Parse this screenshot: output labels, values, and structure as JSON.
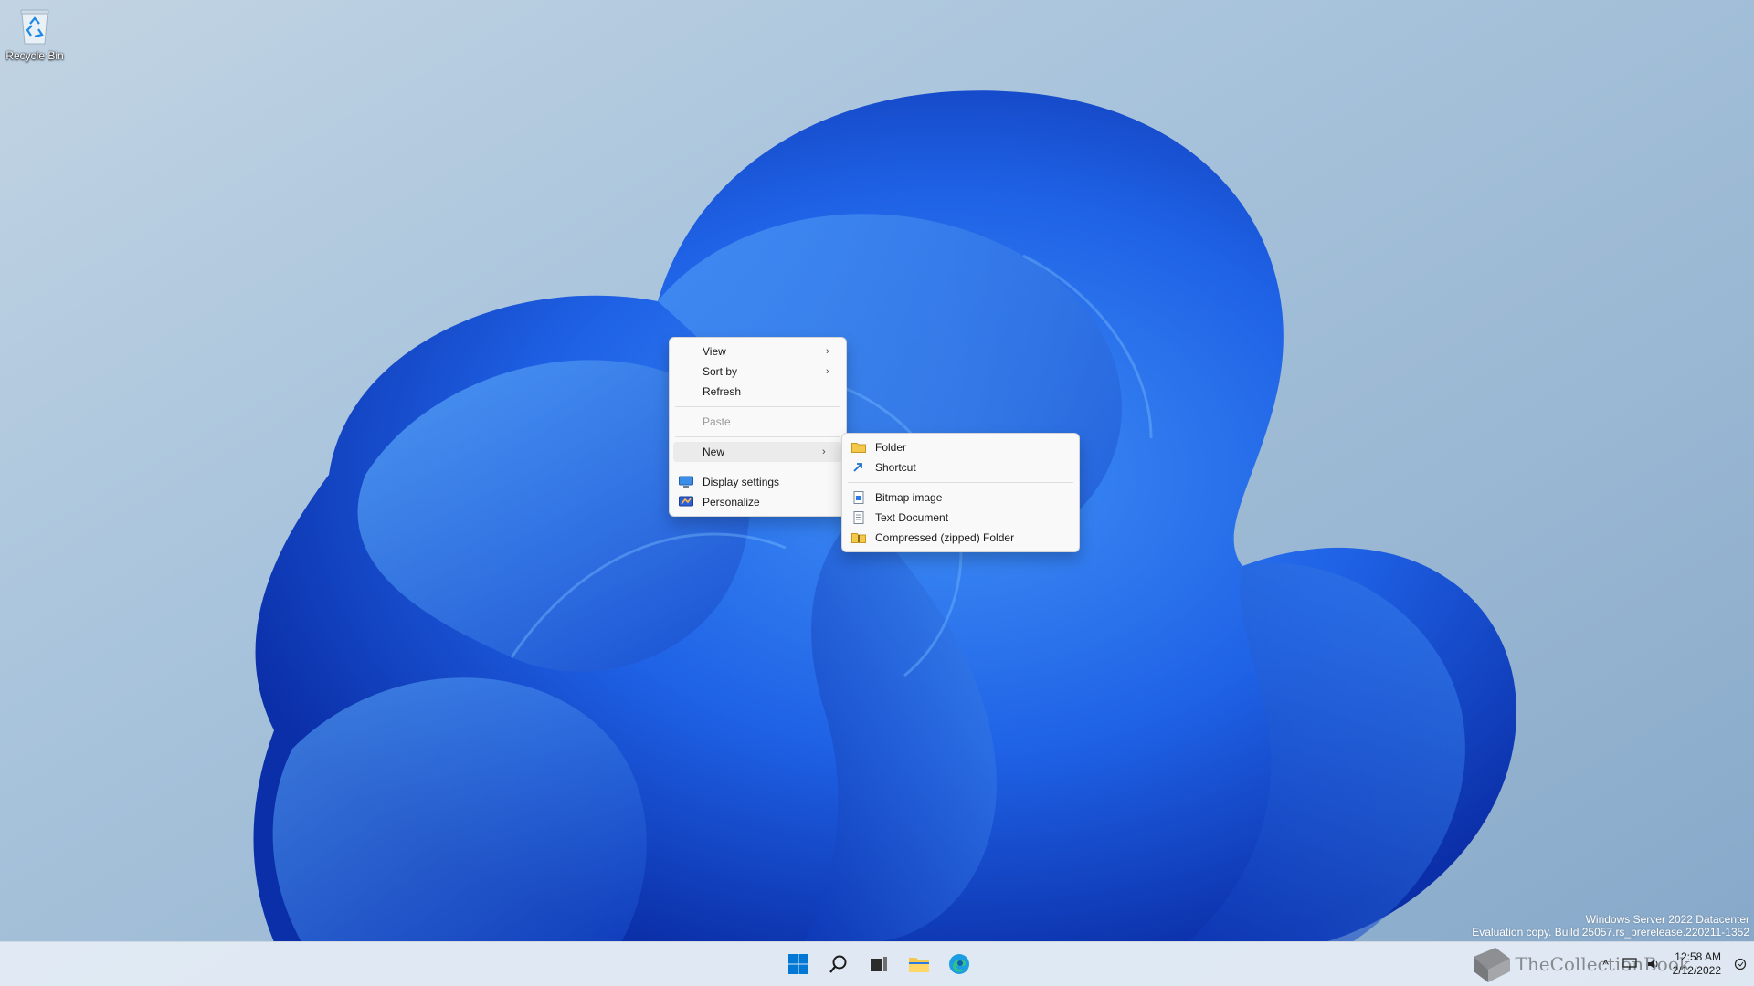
{
  "desktop": {
    "recycle_bin_label": "Recycle Bin"
  },
  "context_menu": {
    "view": "View",
    "sort_by": "Sort by",
    "refresh": "Refresh",
    "paste": "Paste",
    "new": "New",
    "display_settings": "Display settings",
    "personalize": "Personalize"
  },
  "new_submenu": {
    "folder": "Folder",
    "shortcut": "Shortcut",
    "bitmap": "Bitmap image",
    "text_doc": "Text Document",
    "zip_folder": "Compressed (zipped) Folder"
  },
  "watermark": {
    "line1": "Windows Server 2022 Datacenter",
    "line2": "Evaluation copy. Build 25057.rs_prerelease.220211-1352"
  },
  "taskbar": {
    "time": "12:58 AM",
    "date": "2/12/2022",
    "brand": "TheCollectionBook"
  },
  "colors": {
    "wallpaper_bloom": "#1e5fe0",
    "accent": "#0067c0",
    "folder": "#f4c84a"
  }
}
